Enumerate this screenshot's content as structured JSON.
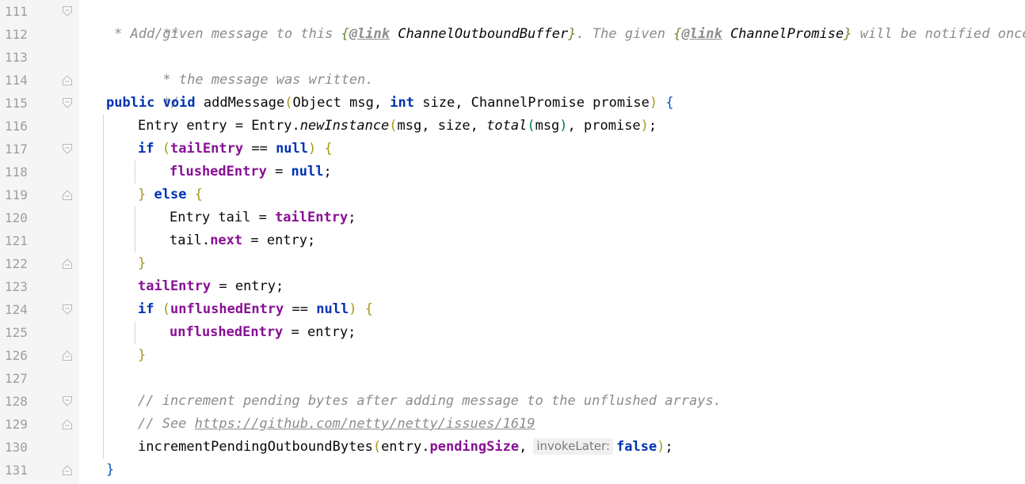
{
  "editor": {
    "line_numbers": [
      "111",
      "112",
      "113",
      "114",
      "115",
      "116",
      "117",
      "118",
      "119",
      "120",
      "121",
      "122",
      "123",
      "124",
      "125",
      "126",
      "127",
      "128",
      "129",
      "130",
      "131"
    ],
    "fold_markers": {
      "111": "fold-start",
      "114": "fold-end",
      "115": "fold-start",
      "117": "fold-start",
      "119": "fold-mid",
      "122": "fold-end",
      "124": "fold-start",
      "126": "fold-end",
      "128": "fold-start",
      "129": "fold-end",
      "131": "fold-end"
    },
    "lines": {
      "l111": {
        "t1": "/**"
      },
      "l112": {
        "t1": "* Add given message to this ",
        "t2": "{",
        "t3": "@link",
        "t4": " ChannelOutboundBuffer",
        "t5": "}",
        "t6": ". The given ",
        "t7": "{",
        "t8": "@link",
        "t9": " ChannelPromise",
        "t10": "}",
        "t11": " will be notified once"
      },
      "l113": {
        "t1": "* the message was written."
      },
      "l114": {
        "t1": "*/"
      },
      "l115": {
        "t1": "public",
        "t2": " ",
        "t3": "void",
        "t4": " addMessage",
        "t5": "(",
        "t6": "Object msg, ",
        "t7": "int",
        "t8": " size, ChannelPromise promise",
        "t9": ")",
        "t10": " ",
        "t11": "{"
      },
      "l116": {
        "t1": "Entry entry = Entry.",
        "t2": "newInstance",
        "t3": "(",
        "t4": "msg, size, ",
        "t5": "total",
        "t6": "(",
        "t7": "msg",
        "t8": ")",
        "t9": ", promise",
        "t10": ")",
        "t11": ";"
      },
      "l117": {
        "t1": "if",
        "t2": " ",
        "t3": "(",
        "t4": "tailEntry",
        "t5": " == ",
        "t6": "null",
        "t7": ")",
        "t8": " ",
        "t9": "{"
      },
      "l118": {
        "t1": "flushedEntry",
        "t2": " = ",
        "t3": "null",
        "t4": ";"
      },
      "l119": {
        "t1": "}",
        "t2": " ",
        "t3": "else",
        "t4": " ",
        "t5": "{"
      },
      "l120": {
        "t1": "Entry tail = ",
        "t2": "tailEntry",
        "t3": ";"
      },
      "l121": {
        "t1": "tail.",
        "t2": "next",
        "t3": " = entry;"
      },
      "l122": {
        "t1": "}"
      },
      "l123": {
        "t1": "tailEntry",
        "t2": " = entry;"
      },
      "l124": {
        "t1": "if",
        "t2": " ",
        "t3": "(",
        "t4": "unflushedEntry",
        "t5": " == ",
        "t6": "null",
        "t7": ")",
        "t8": " ",
        "t9": "{"
      },
      "l125": {
        "t1": "unflushedEntry",
        "t2": " = entry;"
      },
      "l126": {
        "t1": "}"
      },
      "l127": {},
      "l128": {
        "t1": "// increment pending bytes after adding message to the unflushed arrays."
      },
      "l129": {
        "t1": "// See ",
        "t2": "https://github.com/netty/netty/issues/1619"
      },
      "l130": {
        "t1": "incrementPendingOutboundBytes",
        "t2": "(",
        "t3": "entry.",
        "t4": "pendingSize",
        "t5": ",",
        "hint": "invokeLater:",
        "t6": "false",
        "t7": ")",
        "t8": ";"
      },
      "l131": {
        "t1": "}"
      }
    },
    "colors": {
      "keyword": "#0033b3",
      "field": "#871094",
      "comment": "#8c8c8c",
      "gutter_background": "#f5f5f5",
      "line_number": "#9e9e9e",
      "bracket_level_1": "#a29b1d",
      "bracket_level_2": "#007b46",
      "bracket_level_3": "#0057c0"
    }
  }
}
